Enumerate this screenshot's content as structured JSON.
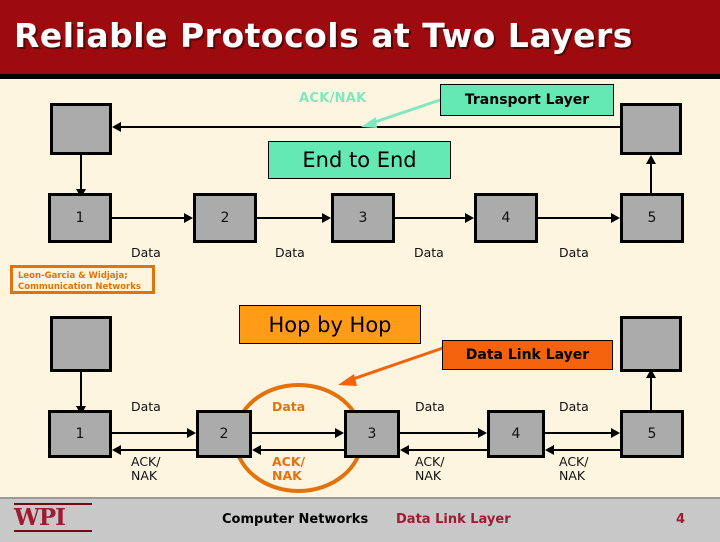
{
  "slide": {
    "title": "Reliable Protocols at Two Layers",
    "title_bg": "#9E0B0F",
    "background": "#FDF5E0"
  },
  "top_diagram": {
    "layer_label": "Transport Layer",
    "scope_label": "End to End",
    "ack_label": "ACK/NAK",
    "nodes": [
      {
        "num": "1"
      },
      {
        "num": "2"
      },
      {
        "num": "3"
      },
      {
        "num": "4"
      },
      {
        "num": "5"
      }
    ],
    "data_labels": [
      "Data",
      "Data",
      "Data",
      "Data"
    ],
    "accent_color": "#64E9B4"
  },
  "bottom_diagram": {
    "layer_label": "Data Link Layer",
    "scope_label": "Hop by Hop",
    "nodes": [
      {
        "num": "1"
      },
      {
        "num": "2"
      },
      {
        "num": "3"
      },
      {
        "num": "4"
      },
      {
        "num": "5"
      }
    ],
    "data_labels": [
      "Data",
      "Data",
      "Data",
      "Data"
    ],
    "ack_labels": [
      "ACK/\nNAK",
      "ACK/\nNAK",
      "ACK/\nNAK",
      "ACK/\nNAK"
    ],
    "highlight_data": "Data",
    "highlight_ack": "ACK/\nNAK",
    "accent_color": "#F4620B"
  },
  "attribution": {
    "line1": "Leon-Garcia & Widjaja;",
    "line2": "Communication Networks",
    "color": "#E2720C"
  },
  "footer": {
    "logo": "WPI",
    "course": "Computer Networks",
    "topic": "Data Link Layer",
    "page": "4",
    "topic_color": "#9E1B32"
  }
}
